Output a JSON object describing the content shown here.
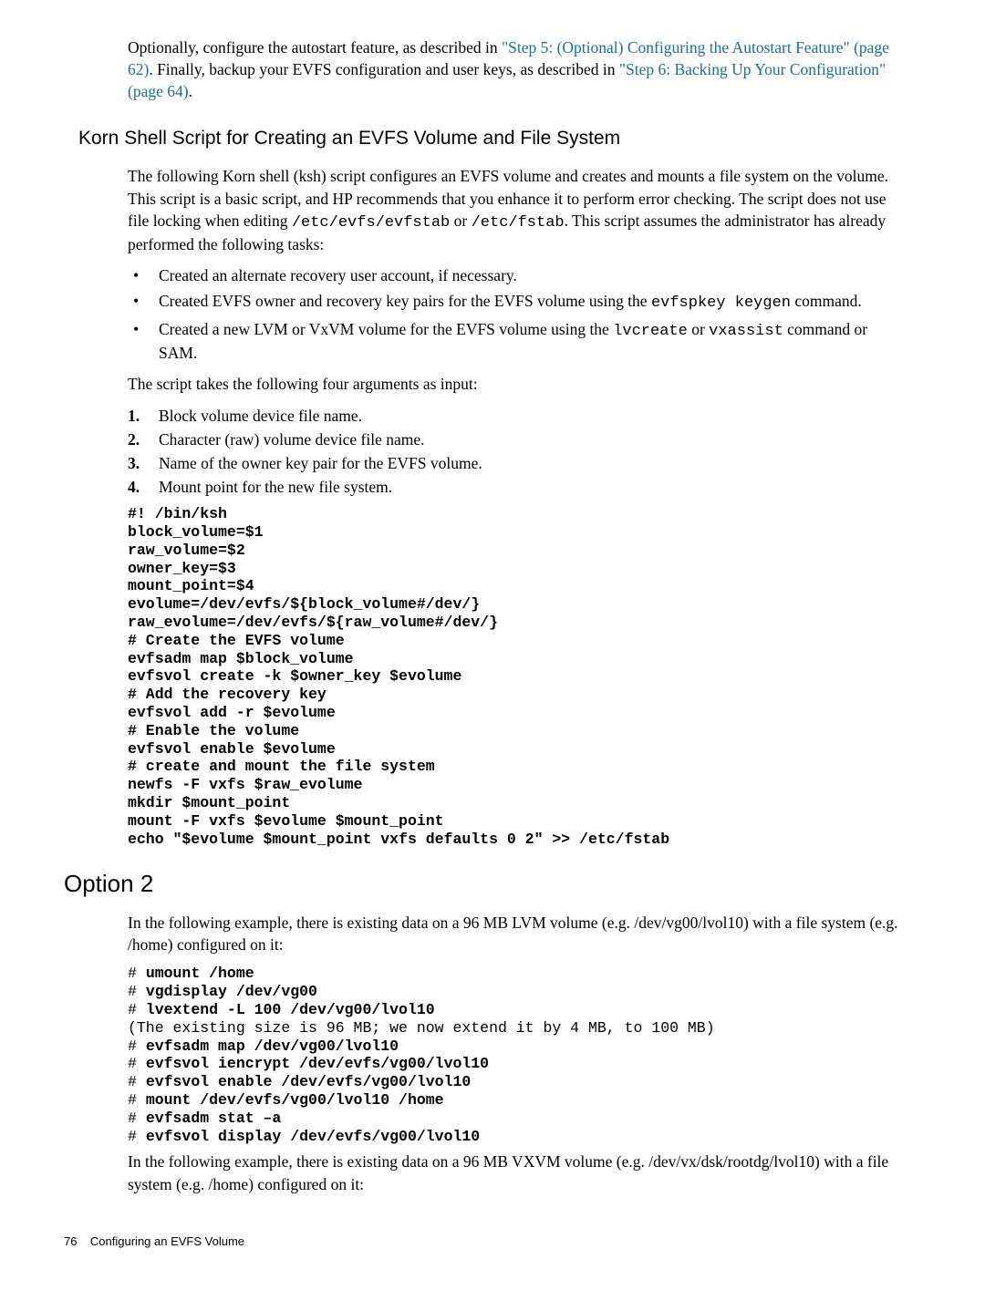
{
  "intro": {
    "p1_a": "Optionally, configure the autostart feature, as described in ",
    "p1_link1": "\"Step 5: (Optional) Configuring the Autostart Feature\" (page 62)",
    "p1_b": ". Finally, backup your EVFS configuration and user keys, as described in ",
    "p1_link2": "\"Step 6: Backing Up Your Configuration\" (page 64)",
    "p1_c": "."
  },
  "korn": {
    "heading": "Korn Shell Script for Creating an EVFS Volume and File System",
    "p1_a": "The following Korn shell (ksh) script configures an EVFS volume and creates and mounts a file system on the volume. This script is a basic script, and HP recommends that you enhance it to perform error checking. The script does not use file locking when editing ",
    "p1_m1": "/etc/evfs/evfstab",
    "p1_b": " or ",
    "p1_m2": "/etc/fstab",
    "p1_c": ". This script assumes the administrator has already performed the following tasks:",
    "bullets": {
      "b1": "Created an alternate recovery user account, if necessary.",
      "b2_a": "Created EVFS owner and recovery key pairs for the EVFS volume using the ",
      "b2_m": "evfspkey keygen",
      "b2_b": " command.",
      "b3_a": "Created a new LVM or VxVM volume for the EVFS volume using the ",
      "b3_m1": "lvcreate",
      "b3_b": " or ",
      "b3_m2": "vxassist",
      "b3_c": " command or SAM."
    },
    "p2": "The script takes the following four arguments as input:",
    "nums": {
      "n1": "Block volume device file name.",
      "n2": "Character (raw) volume device file name.",
      "n3": "Name of the owner key pair for the EVFS volume.",
      "n4": "Mount point for the new file system."
    },
    "script": "#! /bin/ksh\nblock_volume=$1\nraw_volume=$2\nowner_key=$3\nmount_point=$4\nevolume=/dev/evfs/${block_volume#/dev/}\nraw_evolume=/dev/evfs/${raw_volume#/dev/}\n# Create the EVFS volume\nevfsadm map $block_volume\nevfsvol create -k $owner_key $evolume\n# Add the recovery key\nevfsvol add -r $evolume\n# Enable the volume\nevfsvol enable $evolume\n# create and mount the file system\nnewfs -F vxfs $raw_evolume\nmkdir $mount_point\nmount -F vxfs $evolume $mount_point\necho \"$evolume $mount_point vxfs defaults 0 2\" >> /etc/fstab"
  },
  "option2": {
    "heading": "Option 2",
    "p1": "In the following example, there is existing data on a 96 MB LVM volume (e.g. /dev/vg00/lvol10) with a file system (e.g. /home) configured on it:",
    "code_lines": [
      {
        "prefix": "# ",
        "bold": "umount /home"
      },
      {
        "prefix": "# ",
        "bold": "vgdisplay /dev/vg00"
      },
      {
        "prefix": "# ",
        "bold": "lvextend -L 100 /dev/vg00/lvol10"
      },
      {
        "prefix": "",
        "plain": "(The existing size is 96 MB; we now extend it by 4 MB, to 100 MB)"
      },
      {
        "prefix": "# ",
        "bold": "evfsadm map /dev/vg00/lvol10"
      },
      {
        "prefix": "# ",
        "bold": "evfsvol iencrypt /dev/evfs/vg00/lvol10"
      },
      {
        "prefix": "# ",
        "bold": "evfsvol enable /dev/evfs/vg00/lvol10"
      },
      {
        "prefix": "# ",
        "bold": "mount /dev/evfs/vg00/lvol10 /home"
      },
      {
        "prefix": "# ",
        "bold": "evfsadm stat –a"
      },
      {
        "prefix": "# ",
        "bold": "evfsvol display /dev/evfs/vg00/lvol10"
      }
    ],
    "p2": "In the following example, there is existing data on a 96 MB VXVM volume (e.g. /dev/vx/dsk/rootdg/lvol10) with a file system (e.g. /home) configured on it:"
  },
  "footer": {
    "page": "76",
    "title": "Configuring an EVFS Volume"
  }
}
